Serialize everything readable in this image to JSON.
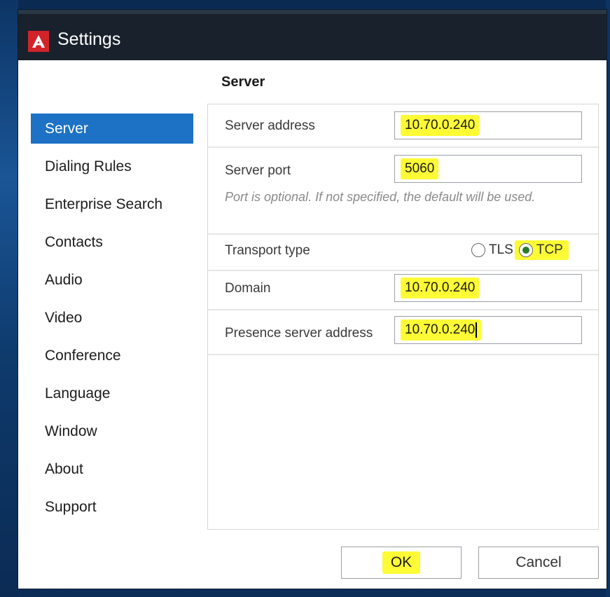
{
  "window": {
    "title": "Settings",
    "logo_letter": "A"
  },
  "sidebar": {
    "items": [
      {
        "label": "Server",
        "selected": true
      },
      {
        "label": "Dialing Rules"
      },
      {
        "label": "Enterprise Search"
      },
      {
        "label": "Contacts"
      },
      {
        "label": "Audio"
      },
      {
        "label": "Video"
      },
      {
        "label": "Conference"
      },
      {
        "label": "Language"
      },
      {
        "label": "Window"
      },
      {
        "label": "About"
      },
      {
        "label": "Support"
      }
    ]
  },
  "server": {
    "section_title": "Server",
    "server_address": {
      "label": "Server address",
      "value": "10.70.0.240"
    },
    "server_port": {
      "label": "Server port",
      "value": "5060",
      "hint": "Port is optional. If not specified, the default will be used."
    },
    "transport": {
      "label": "Transport type",
      "options": [
        "TLS",
        "TCP"
      ],
      "selected": "TCP"
    },
    "domain": {
      "label": "Domain",
      "value": "10.70.0.240"
    },
    "presence": {
      "label": "Presence server address",
      "value": "10.70.0.240"
    }
  },
  "buttons": {
    "ok": "OK",
    "cancel": "Cancel"
  },
  "colors": {
    "selection": "#1d72c5",
    "highlight": "#fdfb35",
    "titlebar": "#19222c",
    "logo": "#d3232a"
  }
}
